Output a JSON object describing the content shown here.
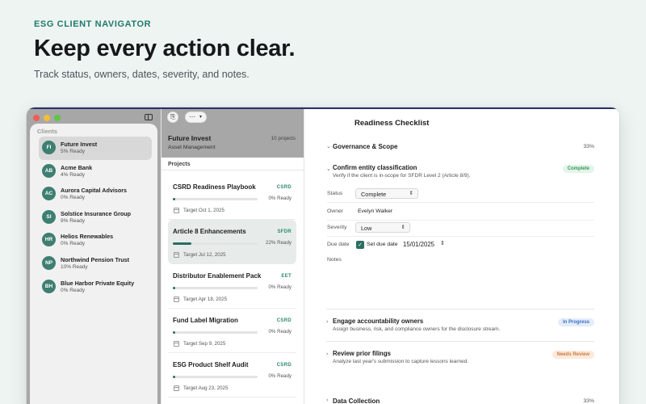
{
  "hero": {
    "eyebrow": "ESG CLIENT NAVIGATOR",
    "headline": "Keep every action clear.",
    "subline": "Track status, owners, dates, severity, and notes."
  },
  "sidebar": {
    "heading": "Clients",
    "clients": [
      {
        "initials": "FI",
        "name": "Future Invest",
        "ready": "5% Ready"
      },
      {
        "initials": "AB",
        "name": "Acme Bank",
        "ready": "4% Ready"
      },
      {
        "initials": "AC",
        "name": "Aurora Capital Advisors",
        "ready": "0% Ready"
      },
      {
        "initials": "SI",
        "name": "Solstice Insurance Group",
        "ready": "9% Ready"
      },
      {
        "initials": "HR",
        "name": "Helios Renewables",
        "ready": "0% Ready"
      },
      {
        "initials": "NP",
        "name": "Northwind Pension Trust",
        "ready": "10% Ready"
      },
      {
        "initials": "BH",
        "name": "Blue Harbor Private Equity",
        "ready": "0% Ready"
      }
    ]
  },
  "middle": {
    "company": "Future Invest",
    "sector": "Asset Management",
    "project_count": "10 projects",
    "projects_label": "Projects",
    "projects": [
      {
        "name": "CSRD Readiness Playbook",
        "tag": "CSRD",
        "progress": 0.03,
        "progress_text": "0% Ready",
        "target": "Target Oct 1, 2025"
      },
      {
        "name": "Article 8 Enhancements",
        "tag": "SFDR",
        "progress": 0.22,
        "progress_text": "22% Ready",
        "target": "Target Jul 12, 2025"
      },
      {
        "name": "Distributor Enablement Pack",
        "tag": "EET",
        "progress": 0.03,
        "progress_text": "0% Ready",
        "target": "Target Apr 18, 2025"
      },
      {
        "name": "Fund Label Migration",
        "tag": "CSRD",
        "progress": 0.03,
        "progress_text": "0% Ready",
        "target": "Target Sep 9, 2025"
      },
      {
        "name": "ESG Product Shelf Audit",
        "tag": "CSRD",
        "progress": 0.03,
        "progress_text": "0% Ready",
        "target": "Target Aug 23, 2025"
      }
    ]
  },
  "detail": {
    "title": "Readiness Checklist",
    "sections": [
      {
        "label": "Governance & Scope",
        "pct": "33%"
      },
      {
        "label": "Data Collection",
        "pct": "33%"
      }
    ],
    "tasks": [
      {
        "title": "Confirm entity classification",
        "desc": "Verify if the client is in-scope for SFDR Level 2 (Article 8/9).",
        "badge": "Complete"
      },
      {
        "title": "Engage accountability owners",
        "desc": "Assign business, risk, and compliance owners for the disclosure stream.",
        "badge": "In Progress"
      },
      {
        "title": "Review prior filings",
        "desc": "Analyze last year's submission to capture lessons learned.",
        "badge": "Needs Review"
      }
    ],
    "fields": {
      "status_label": "Status",
      "status_value": "Complete",
      "owner_label": "Owner",
      "owner_value": "Evelyn Walker",
      "severity_label": "Severity",
      "severity_value": "Low",
      "due_label": "Due date",
      "due_checkbox_label": "Set due date",
      "due_value": "15/01/2025",
      "notes_label": "Notes"
    }
  }
}
